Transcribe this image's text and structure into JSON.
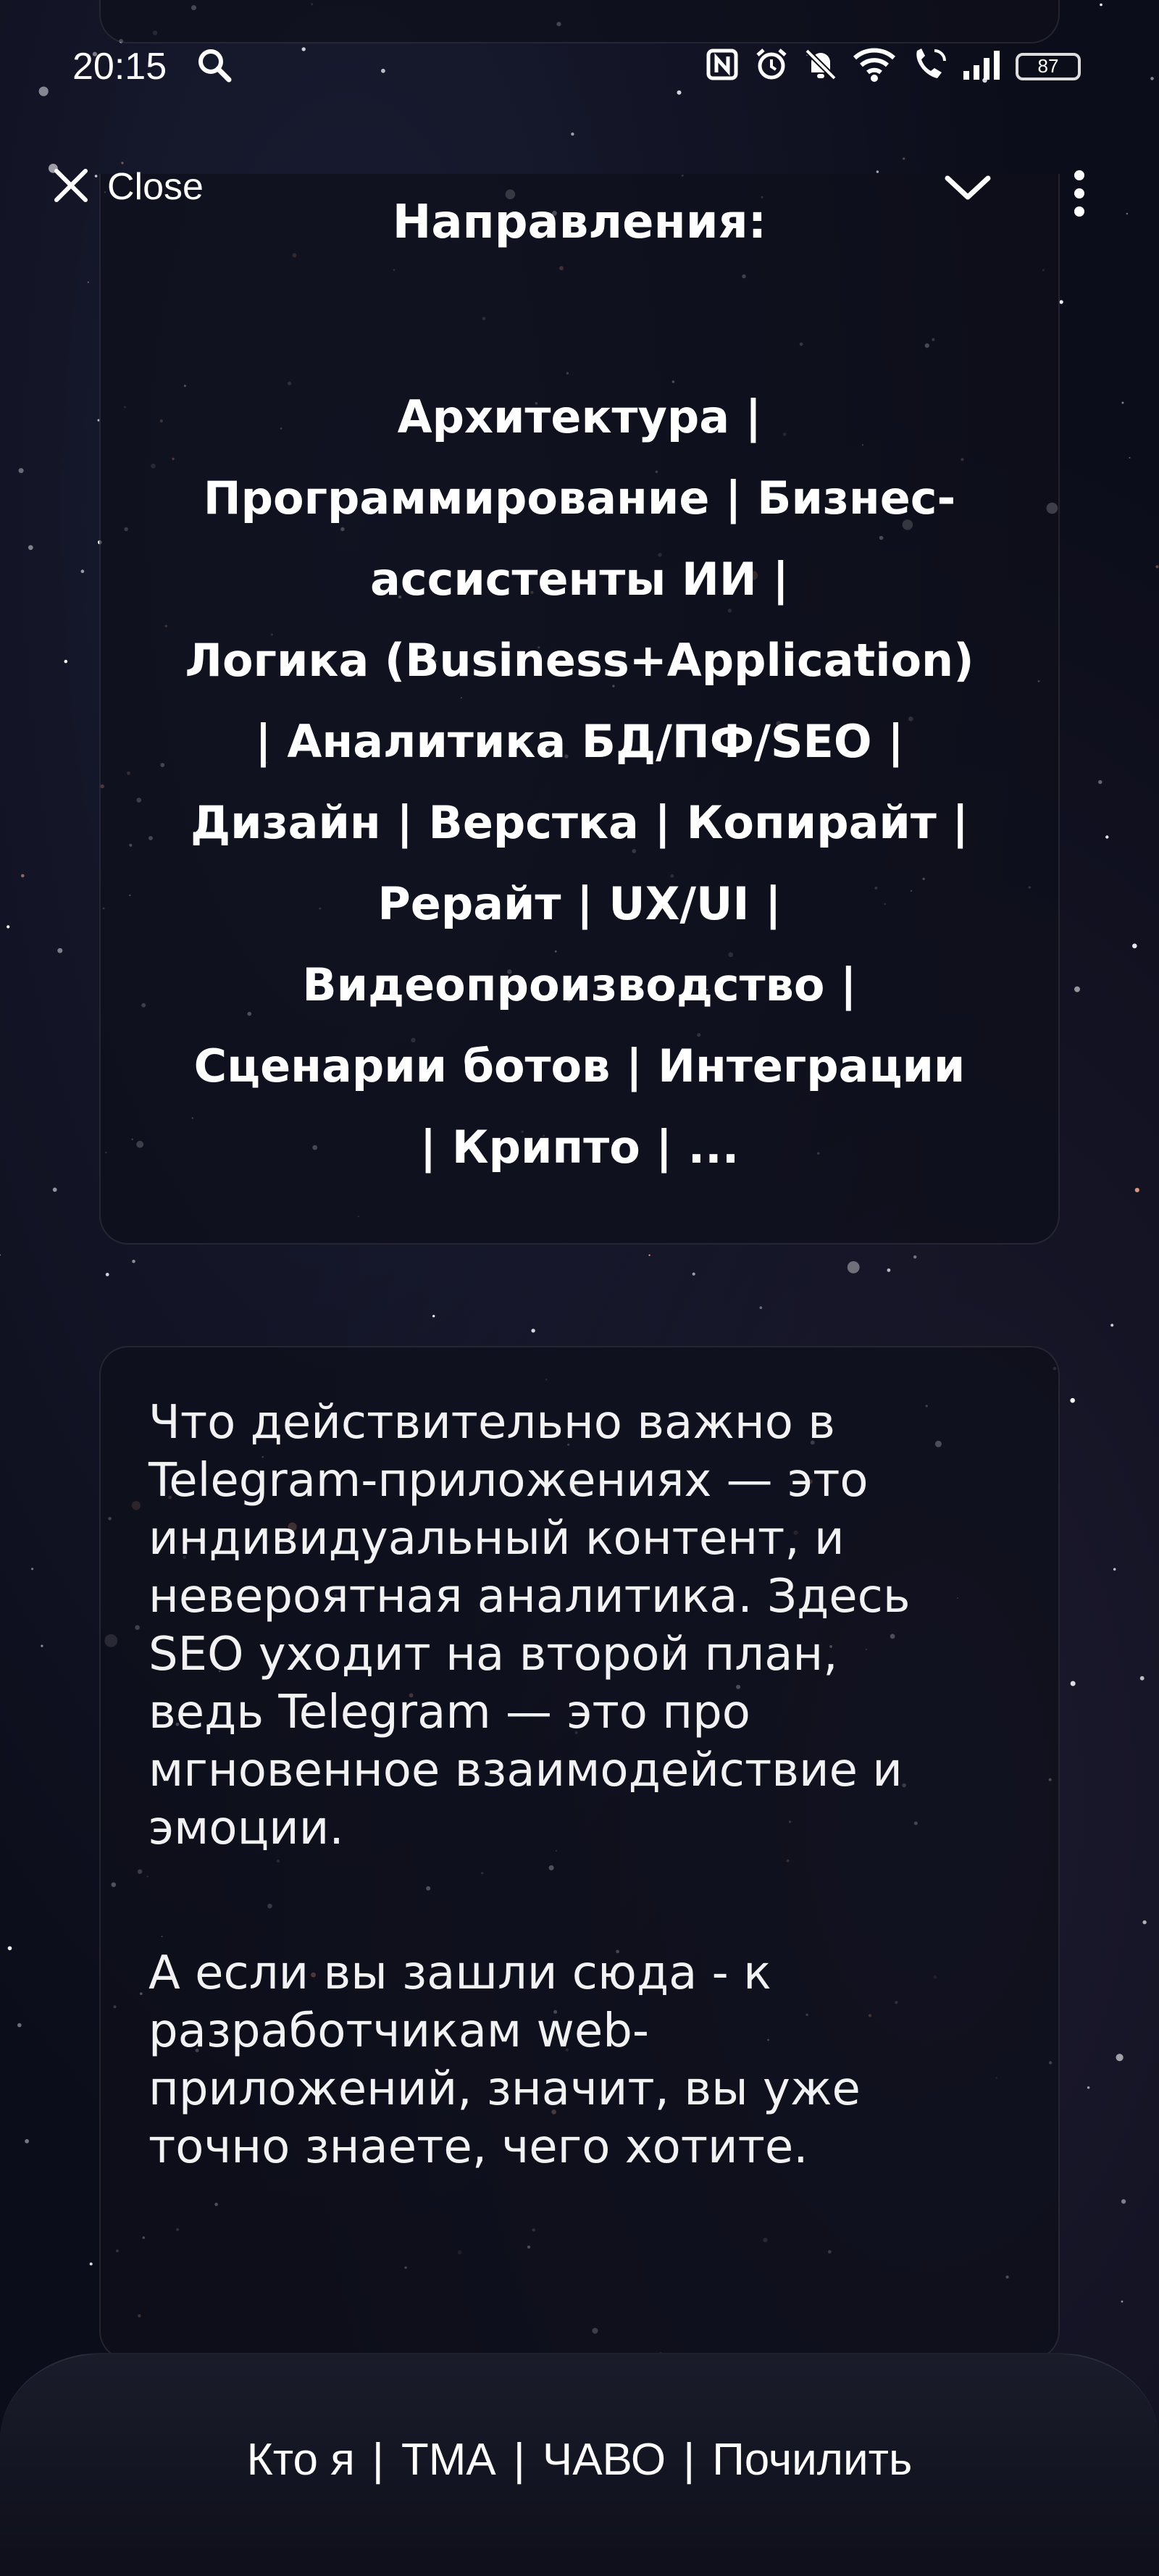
{
  "status_bar": {
    "time": "20:15",
    "battery": "87",
    "icons": [
      "search-icon",
      "nfc-icon",
      "alarm-icon",
      "mute-icon",
      "wifi-icon",
      "call-icon",
      "signal-icon",
      "battery-icon"
    ]
  },
  "header": {
    "close_label": "Close"
  },
  "directions": {
    "heading": "Направления:",
    "lines": [
      "Архитектура |",
      "Программирование | Бизнес-",
      "ассистенты ИИ |",
      "Логика (Business+Application)",
      "| Аналитика БД/ПФ/SEO |",
      "Дизайн | Верстка | Копирайт |",
      "Рерайт | UX/UI |",
      "Видеопроизводство |",
      "Сценарии ботов | Интеграции",
      "| Крипто | ..."
    ]
  },
  "info": {
    "p1_lines": [
      "Что действительно важно в",
      "Telegram-приложениях — это",
      "индивидуальный контент, и",
      "невероятная аналитика. Здесь",
      "SEO уходит на второй план,",
      "ведь Telegram — это про",
      "мгновенное взаимодействие и",
      "эмоции."
    ],
    "p2_lines": [
      "А если вы зашли сюда - к",
      "разработчикам web-",
      "приложений, значит, вы уже",
      "точно знаете, чего хотите."
    ]
  },
  "bottom_nav": {
    "items": [
      "Кто я",
      "TMA",
      "ЧАВО",
      "Почилить"
    ],
    "separator": "|"
  }
}
